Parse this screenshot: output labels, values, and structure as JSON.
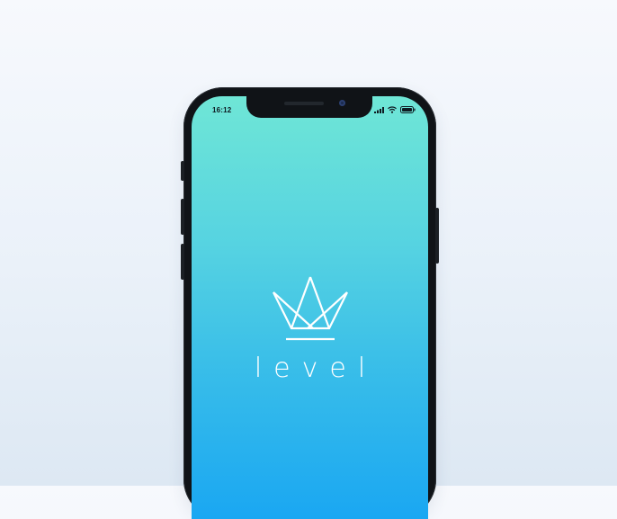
{
  "status_bar": {
    "time": "16:12",
    "icons": [
      "signal-bars-icon",
      "wifi-icon",
      "battery-icon"
    ]
  },
  "splash": {
    "brand_name": "level",
    "logo_icon": "crown-icon"
  },
  "colors": {
    "page_background": "#eef3fa",
    "phone_frame": "#101317",
    "screen_gradient_top": "#6fe6d6",
    "screen_gradient_bottom": "#1aa7f2",
    "logo_color": "#ffffff"
  }
}
